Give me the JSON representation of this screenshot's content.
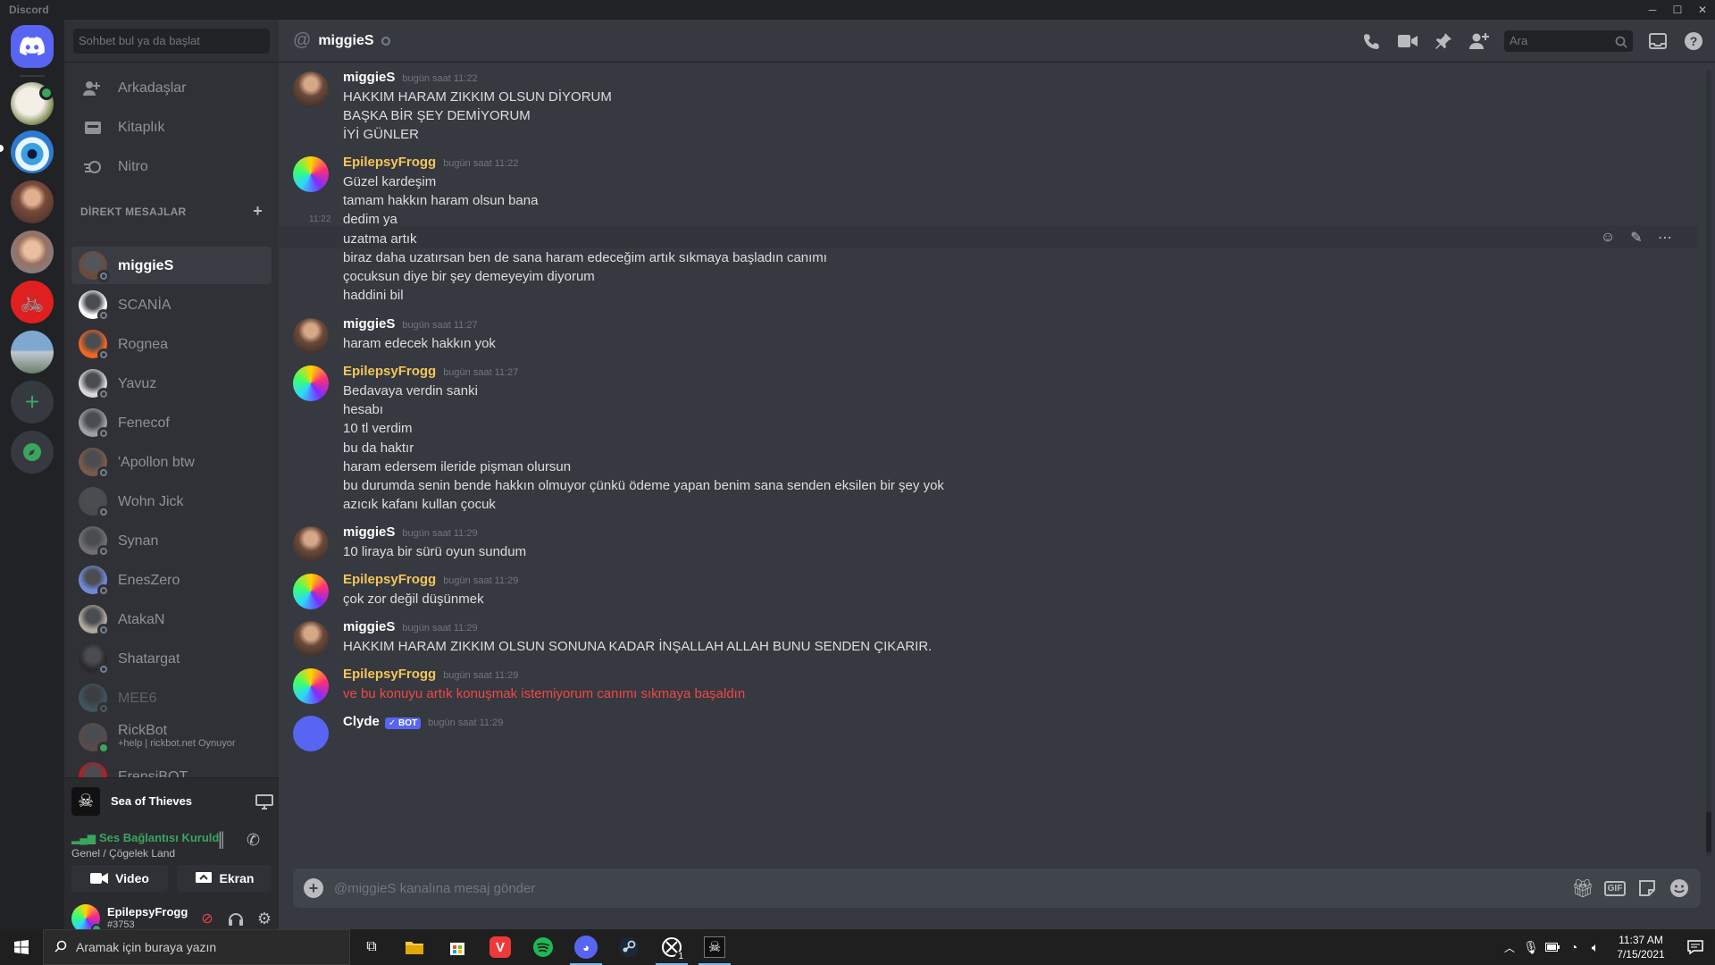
{
  "window": {
    "title": "Discord"
  },
  "sidebar": {
    "search_placeholder": "Sohbet bul ya da başlat",
    "nav": [
      {
        "label": "Arkadaşlar",
        "icon": "friends-icon"
      },
      {
        "label": "Kitaplık",
        "icon": "library-icon"
      },
      {
        "label": "Nitro",
        "icon": "nitro-icon"
      }
    ],
    "dm_header": "DİREKT MESAJLAR",
    "dms": [
      {
        "name": "miggieS",
        "status": "offline",
        "selected": true,
        "color": "#6b4a3a"
      },
      {
        "name": "SCANİA",
        "status": "offline",
        "color": "#ffffff"
      },
      {
        "name": "Rognea",
        "status": "offline",
        "color": "#f26522"
      },
      {
        "name": "Yavuz",
        "status": "offline",
        "color": "#d8d8d8"
      },
      {
        "name": "Fenecof",
        "status": "offline",
        "color": "#9aa0a6"
      },
      {
        "name": "'Apollon btw",
        "status": "offline",
        "color": "#7a5a4a"
      },
      {
        "name": "Wohn Jick",
        "status": "offline",
        "color": "#4a4a4a"
      },
      {
        "name": "Synan",
        "status": "offline",
        "color": "#6f6f6f"
      },
      {
        "name": "EnesZero",
        "status": "offline",
        "color": "#7289da"
      },
      {
        "name": "AtakaN",
        "status": "offline",
        "color": "#b0a89a"
      },
      {
        "name": "Shatargat",
        "status": "offline",
        "color": "#2a2a2a"
      },
      {
        "name": "MEE6",
        "status": "offline",
        "color": "#4e7a86",
        "dim": true
      },
      {
        "name": "RickBot",
        "status": "online",
        "sub": "+help | rickbot.net Oynuyor",
        "color": "#5a4a4a"
      },
      {
        "name": "ErensiBOT",
        "status": "online",
        "color": "#c4161c"
      }
    ],
    "activity": {
      "game": "Sea of Thieves"
    },
    "voice": {
      "status": "Ses Bağlantısı Kuruldu",
      "channel": "Genel / Çögelek Land",
      "video_label": "Video",
      "screen_label": "Ekran"
    },
    "user": {
      "name": "EpilepsyFrogg",
      "tag": "#3753"
    }
  },
  "header": {
    "channel": "miggieS",
    "search_placeholder": "Ara"
  },
  "messages": [
    {
      "user": "miggieS",
      "time": "bugün saat 11:22",
      "lines": [
        "HAKKIM HARAM ZIKKIM OLSUN DİYORUM",
        "BAŞKA BİR ŞEY DEMİYORUM",
        "İYİ GÜNLER"
      ]
    },
    {
      "user": "EpilepsyFrogg",
      "time": "bugün saat 11:22",
      "lines": [
        "Güzel kardeşim",
        "tamam hakkın haram olsun bana",
        "dedim ya",
        "uzatma artık",
        "biraz daha uzatırsan ben de sana haram edeceğim artık sıkmaya başladın canımı",
        "çocuksun diye bir şey demeyeyim diyorum",
        "haddini bil"
      ],
      "hover_time": "11:22"
    },
    {
      "user": "miggieS",
      "time": "bugün saat 11:27",
      "lines": [
        "haram edecek hakkın yok"
      ]
    },
    {
      "user": "EpilepsyFrogg",
      "time": "bugün saat 11:27",
      "lines": [
        "Bedavaya verdin sanki",
        "hesabı",
        "10 tl verdim",
        "bu da haktır",
        "haram edersem ileride pişman olursun",
        "bu durumda senin bende hakkın olmuyor çünkü ödeme yapan benim sana senden eksilen bir şey yok",
        "azıcık kafanı kullan çocuk"
      ]
    },
    {
      "user": "miggieS",
      "time": "bugün saat 11:29",
      "lines": [
        "10 liraya bir sürü oyun sundum"
      ]
    },
    {
      "user": "EpilepsyFrogg",
      "time": "bugün saat 11:29",
      "lines": [
        "çok zor değil düşünmek"
      ]
    },
    {
      "user": "miggieS",
      "time": "bugün saat 11:29",
      "lines": [
        "HAKKIM HARAM ZIKKIM OLSUN SONUNA KADAR İNŞALLAH ALLAH BUNU SENDEN ÇIKARIR."
      ]
    },
    {
      "user": "EpilepsyFrogg",
      "time": "bugün saat 11:29",
      "lines": [
        "ve bu konuyu artık konuşmak istemiyorum canımı sıkmaya başaldın"
      ],
      "red": true
    },
    {
      "user": "Clyde",
      "bot_badge": "✓ BOT",
      "time": "bugün saat 11:29",
      "lines": []
    }
  ],
  "composer": {
    "placeholder": "@miggieS kanalına mesaj gönder",
    "gif_label": "GIF"
  },
  "taskbar": {
    "search_placeholder": "Aramak için buraya yazın",
    "time": "11:37 AM",
    "date": "7/15/2021",
    "xbox_badge": "1"
  }
}
